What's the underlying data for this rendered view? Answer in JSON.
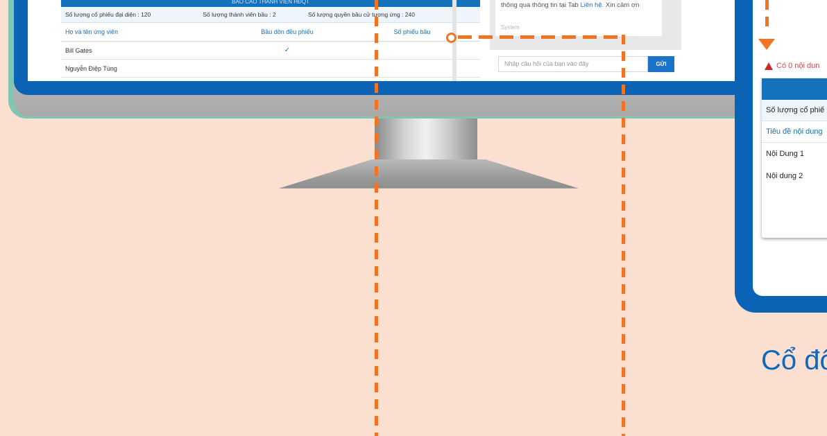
{
  "report": {
    "title": "BÁO CÁO THÀNH VIÊN HĐQT",
    "summary": {
      "shares": "Số lượng cổ phiếu đại diện : 120",
      "members": "Số lượng thành viên bầu : 2",
      "votes": "Số lượng quyền bầu cử tương ứng : 240"
    },
    "columns": [
      "Họ và tên ứng viên",
      "Bầu dồn đều phiếu",
      "Số phiếu bầu"
    ],
    "rows": [
      {
        "name": "Bill Gates",
        "even": "✓",
        "votes": ""
      },
      {
        "name": "Nguyễn Điệp Tùng",
        "even": "",
        "votes": ""
      }
    ]
  },
  "chat": {
    "message_pre": "thông qua thông tin tại Tab ",
    "message_link": "Liên hệ",
    "message_post": ". Xin cảm ơn",
    "sender": "System",
    "input_placeholder": "Nhập câu hỏi của bạn vào đây",
    "send_label": "GỬI"
  },
  "device": {
    "alert_text": "Có 0 nội dun",
    "rows": [
      "Số lượng cổ phiế",
      "Tiêu đề nội dung",
      "Nội Dung 1",
      "Nội dung 2"
    ]
  },
  "caption": "Cổ đô",
  "colors": {
    "background": "#fbe0d2",
    "brand_blue": "#0b63b6",
    "accent_orange": "#f07424",
    "alert_red": "#cc2a2a"
  },
  "icons": [
    "check-icon",
    "warning-icon",
    "arrow-down-icon",
    "connector-dot-icon"
  ]
}
